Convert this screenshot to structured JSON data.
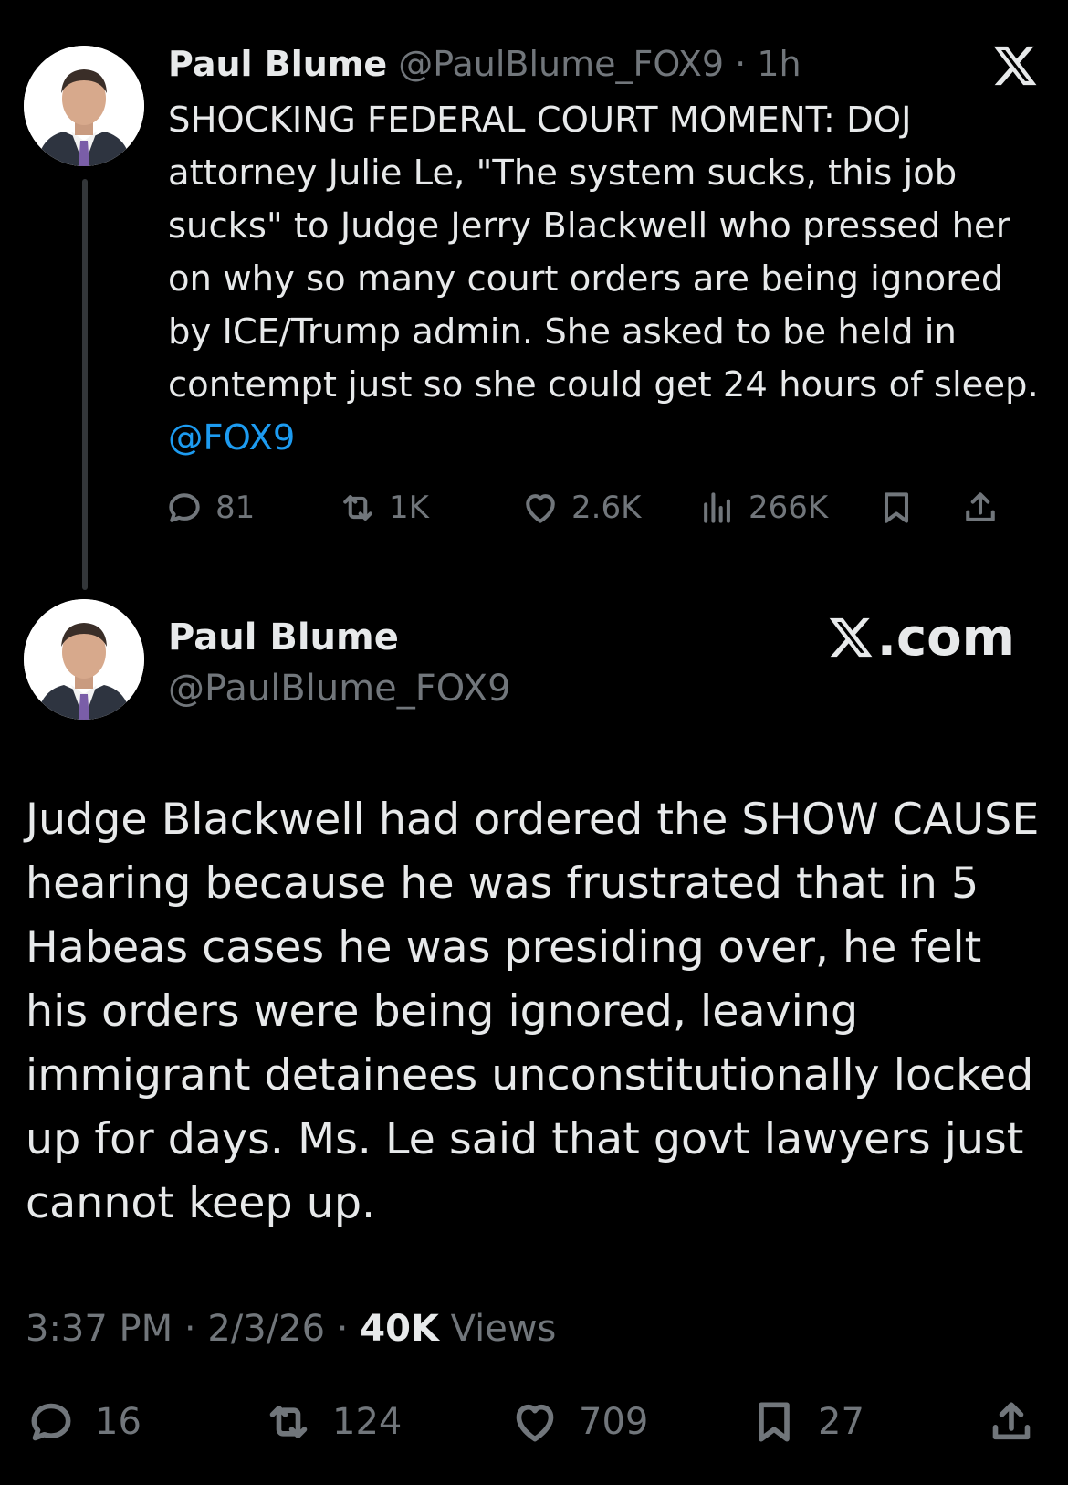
{
  "tweet1": {
    "author_name": "Paul Blume",
    "handle": "@PaulBlume_FOX9",
    "separator": " · ",
    "time": "1h",
    "text": "SHOCKING FEDERAL COURT MOMENT: DOJ attorney Julie Le, \"The system sucks, this job sucks\" to Judge Jerry Blackwell who pressed her on why so many court orders are being ignored by ICE/Trump admin. She asked to be held in contempt just so she could get 24 hours of sleep. ",
    "mention": "@FOX9",
    "replies": "81",
    "reposts": "1K",
    "likes": "2.6K",
    "views": "266K",
    "icons": [
      "x-logo-icon",
      "reply-icon",
      "repost-icon",
      "like-icon",
      "views-icon",
      "bookmark-icon",
      "share-icon"
    ]
  },
  "tweet2": {
    "author_name": "Paul Blume",
    "handle": "@PaulBlume_FOX9",
    "brand": ".com",
    "text": "Judge Blackwell had ordered the SHOW CAUSE hearing because he was frustrated that in 5 Habeas cases he was presiding over, he felt his orders were being ignored, leaving immigrant detainees unconstitutionally locked up for days. Ms. Le said that govt lawyers just cannot  keep up.",
    "time": "3:37 PM",
    "sep1": " · ",
    "date": "2/3/26",
    "sep2": " · ",
    "views_count": "40K",
    "views_label": " Views",
    "replies": "16",
    "reposts": "124",
    "likes": "709",
    "bookmarks": "27"
  },
  "colors": {
    "background": "#000000",
    "text": "#e7e9ea",
    "muted": "#71767b",
    "link": "#1d9bf0"
  }
}
